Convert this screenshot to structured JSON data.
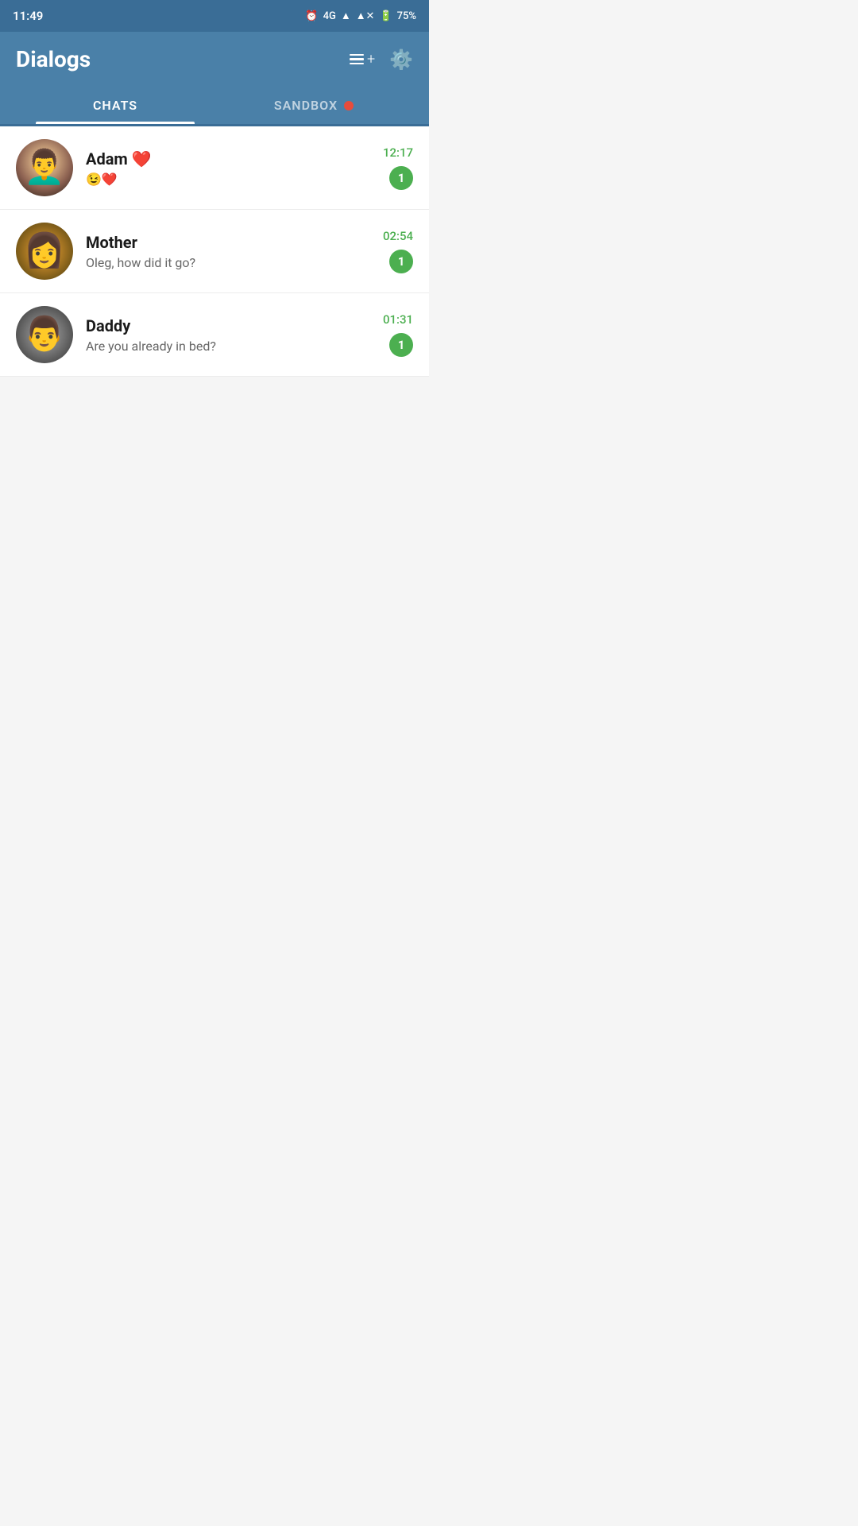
{
  "statusBar": {
    "time": "11:49",
    "signal": "4G",
    "battery": "75%"
  },
  "header": {
    "title": "Dialogs",
    "composeLabel": "compose",
    "settingsLabel": "settings"
  },
  "tabs": [
    {
      "id": "chats",
      "label": "CHATS",
      "active": true
    },
    {
      "id": "sandbox",
      "label": "SANDBOX",
      "active": false,
      "hasDot": true
    }
  ],
  "chats": [
    {
      "id": "adam",
      "name": "Adam ❤️",
      "nameEmoji": "Adam ❤️",
      "preview": "😉❤️",
      "time": "12:17",
      "unread": "1",
      "avatarEmoji": "👨‍🦱"
    },
    {
      "id": "mother",
      "name": "Mother",
      "preview": "Oleg, how did it go?",
      "time": "02:54",
      "unread": "1",
      "avatarEmoji": "👩"
    },
    {
      "id": "daddy",
      "name": "Daddy",
      "preview": "Are you already in bed?",
      "time": "01:31",
      "unread": "1",
      "avatarEmoji": "👨"
    }
  ]
}
